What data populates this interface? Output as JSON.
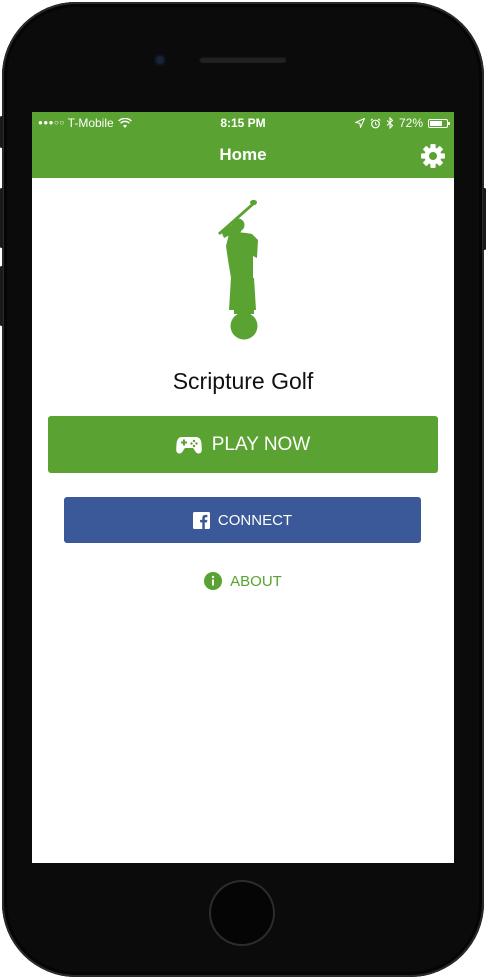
{
  "status_bar": {
    "signal": "●●●○○",
    "carrier": "T-Mobile",
    "time": "8:15 PM",
    "battery_text": "72%",
    "battery_level": 0.72
  },
  "navbar": {
    "title": "Home",
    "settings_icon": "gear-icon"
  },
  "main": {
    "logo_icon": "golfer-statue-icon",
    "app_title": "Scripture Golf",
    "play_button": {
      "label": "PLAY NOW",
      "icon": "gamepad-icon"
    },
    "connect_button": {
      "label": "CONNECT",
      "icon": "facebook-icon"
    },
    "about_link": {
      "label": "ABOUT",
      "icon": "info-circle-icon"
    }
  },
  "colors": {
    "brand_green": "#5aa231",
    "facebook_blue": "#3b5998"
  }
}
